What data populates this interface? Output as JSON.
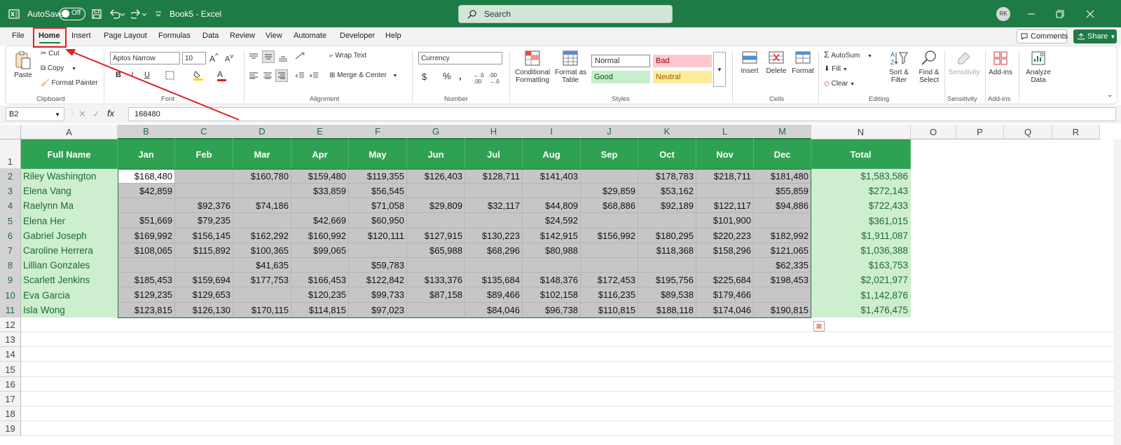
{
  "titlebar": {
    "autosave_label": "AutoSave",
    "autosave_state": "Off",
    "doc_title": "Book5 - Excel",
    "search_placeholder": "Search",
    "user_initials": "RK"
  },
  "tabs": [
    "File",
    "Home",
    "Insert",
    "Page Layout",
    "Formulas",
    "Data",
    "Review",
    "View",
    "Automate",
    "Developer",
    "Help"
  ],
  "actions": {
    "comments": "Comments",
    "share": "Share"
  },
  "ribbon": {
    "clipboard": {
      "paste": "Paste",
      "cut": "Cut",
      "copy": "Copy",
      "format_painter": "Format Painter",
      "group": "Clipboard"
    },
    "font": {
      "family": "Aptos Narrow",
      "size": "10",
      "group": "Font"
    },
    "alignment": {
      "wrap": "Wrap Text",
      "merge": "Merge & Center",
      "group": "Alignment"
    },
    "number": {
      "format": "Currency",
      "group": "Number"
    },
    "styles": {
      "cond_line1": "Conditional",
      "cond_line2": "Formatting",
      "fat_line1": "Format as",
      "fat_line2": "Table",
      "normal": "Normal",
      "bad": "Bad",
      "good": "Good",
      "neutral": "Neutral",
      "group": "Styles"
    },
    "cells": {
      "insert": "Insert",
      "delete": "Delete",
      "format": "Format",
      "group": "Cells"
    },
    "editing": {
      "autosum": "AutoSum",
      "fill": "Fill",
      "clear": "Clear",
      "sort_line1": "Sort &",
      "sort_line2": "Filter",
      "find_line1": "Find &",
      "find_line2": "Select",
      "group": "Editing"
    },
    "sensitivity": {
      "label": "Sensitivity",
      "group": "Sensitivity"
    },
    "addins": {
      "label": "Add-ins",
      "group": "Add-ins"
    },
    "analyze": {
      "line1": "Analyze",
      "line2": "Data"
    }
  },
  "formula_bar": {
    "name_box": "B2",
    "formula": "168480"
  },
  "columns": [
    "A",
    "B",
    "C",
    "D",
    "E",
    "F",
    "G",
    "H",
    "I",
    "J",
    "K",
    "L",
    "M",
    "N",
    "O",
    "P",
    "Q",
    "R"
  ],
  "row_numbers": [
    "1",
    "2",
    "3",
    "4",
    "5",
    "6",
    "7",
    "8",
    "9",
    "10",
    "11",
    "12",
    "13",
    "14",
    "15",
    "16",
    "17",
    "18",
    "19"
  ],
  "table": {
    "name_header": "Full Name",
    "months": [
      "Jan",
      "Feb",
      "Mar",
      "Apr",
      "May",
      "Jun",
      "Jul",
      "Aug",
      "Sep",
      "Oct",
      "Nov",
      "Dec"
    ],
    "total_header": "Total",
    "rows": [
      {
        "name": "Riley Washington",
        "values": [
          "$168,480",
          "",
          "$160,780",
          "$159,480",
          "$119,355",
          "$126,403",
          "$128,711",
          "$141,403",
          "",
          "$178,783",
          "$218,711",
          "$181,480"
        ],
        "total": "$1,583,586"
      },
      {
        "name": "Elena Vang",
        "values": [
          "$42,859",
          "",
          "",
          "$33,859",
          "$56,545",
          "",
          "",
          "",
          "$29,859",
          "$53,162",
          "",
          "$55,859"
        ],
        "total": "$272,143"
      },
      {
        "name": "Raelynn Ma",
        "values": [
          "",
          "$92,376",
          "$74,186",
          "",
          "$71,058",
          "$29,809",
          "$32,117",
          "$44,809",
          "$68,886",
          "$92,189",
          "$122,117",
          "$94,886"
        ],
        "total": "$722,433"
      },
      {
        "name": "Elena Her",
        "values": [
          "$51,669",
          "$79,235",
          "",
          "$42,669",
          "$60,950",
          "",
          "",
          "$24,592",
          "",
          "",
          "$101,900",
          ""
        ],
        "total": "$361,015"
      },
      {
        "name": "Gabriel Joseph",
        "values": [
          "$169,992",
          "$156,145",
          "$162,292",
          "$160,992",
          "$120,111",
          "$127,915",
          "$130,223",
          "$142,915",
          "$156,992",
          "$180,295",
          "$220,223",
          "$182,992"
        ],
        "total": "$1,911,087"
      },
      {
        "name": "Caroline Herrera",
        "values": [
          "$108,065",
          "$115,892",
          "$100,365",
          "$99,065",
          "",
          "$65,988",
          "$68,296",
          "$80,988",
          "",
          "$118,368",
          "$158,296",
          "$121,065"
        ],
        "total": "$1,036,388"
      },
      {
        "name": "Lillian Gonzales",
        "values": [
          "",
          "",
          "$41,635",
          "",
          "$59,783",
          "",
          "",
          "",
          "",
          "",
          "",
          "$62,335"
        ],
        "total": "$163,753"
      },
      {
        "name": "Scarlett Jenkins",
        "values": [
          "$185,453",
          "$159,694",
          "$177,753",
          "$166,453",
          "$122,842",
          "$133,376",
          "$135,684",
          "$148,376",
          "$172,453",
          "$195,756",
          "$225,684",
          "$198,453"
        ],
        "total": "$2,021,977"
      },
      {
        "name": "Eva Garcia",
        "values": [
          "$129,235",
          "$129,653",
          "",
          "$120,235",
          "$99,733",
          "$87,158",
          "$89,466",
          "$102,158",
          "$116,235",
          "$89,538",
          "$179,466",
          ""
        ],
        "total": "$1,142,876"
      },
      {
        "name": "Isla Wong",
        "values": [
          "$123,815",
          "$126,130",
          "$170,115",
          "$114,815",
          "$97,023",
          "",
          "$84,046",
          "$96,738",
          "$110,815",
          "$188,118",
          "$174,046",
          "$190,815"
        ],
        "total": "$1,476,475"
      }
    ]
  },
  "colors": {
    "excel_green": "#1e7b45",
    "header_fill": "#2fa152",
    "name_fill": "#cdeecf",
    "selection_fill": "#c6c6c6",
    "annotation": "#e02020"
  }
}
